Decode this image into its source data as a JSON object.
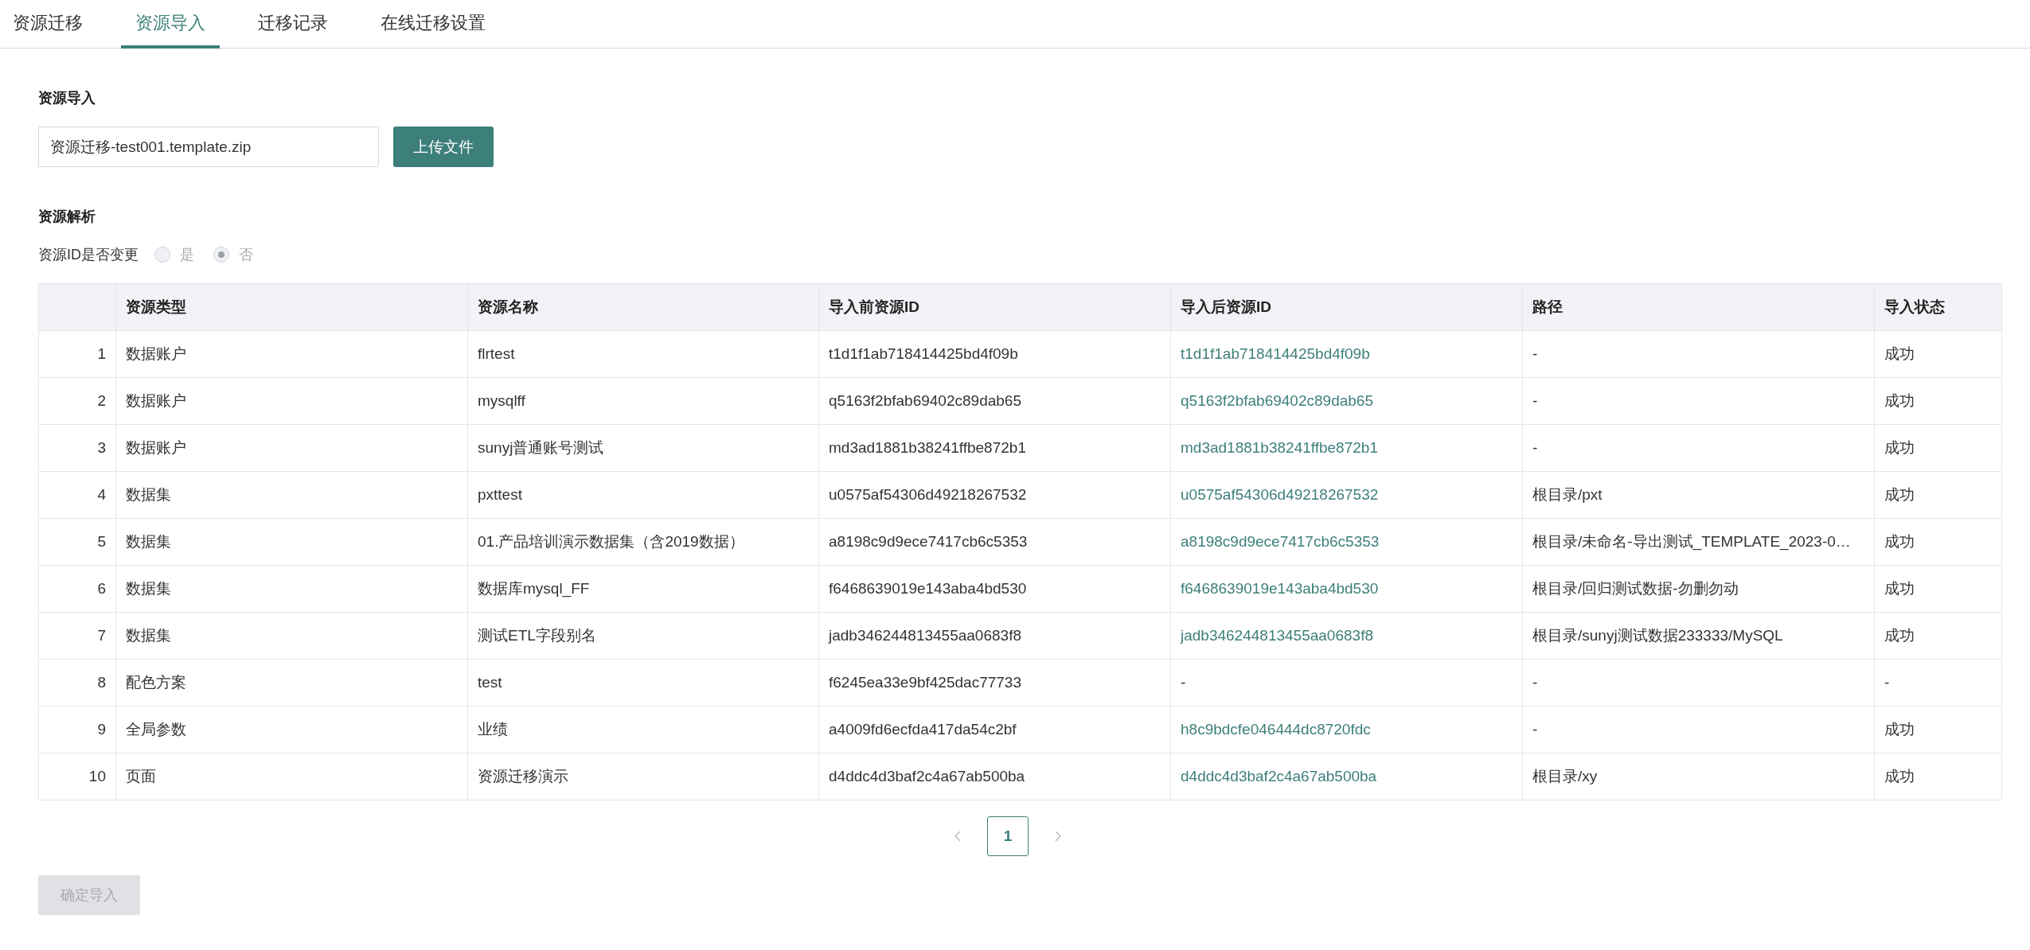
{
  "tabs": [
    {
      "label": "资源迁移",
      "selected": false
    },
    {
      "label": "资源导入",
      "selected": true
    },
    {
      "label": "迁移记录",
      "selected": false
    },
    {
      "label": "在线迁移设置",
      "selected": false
    }
  ],
  "import_section": {
    "title": "资源导入",
    "file_field": {
      "value": "资源迁移-test001.template.zip"
    },
    "upload_button": "上传文件"
  },
  "parse_section": {
    "title": "资源解析",
    "id_change": {
      "label": "资源ID是否变更",
      "disabled": true,
      "options": [
        {
          "label": "是",
          "selected": false
        },
        {
          "label": "否",
          "selected": true
        }
      ]
    }
  },
  "table": {
    "columns": [
      "资源类型",
      "资源名称",
      "导入前资源ID",
      "导入后资源ID",
      "路径",
      "导入状态"
    ],
    "rows": [
      {
        "index": "1",
        "type": "数据账户",
        "name": "flrtest",
        "before_id": "t1d1f1ab718414425bd4f09b",
        "after_id": "t1d1f1ab718414425bd4f09b",
        "linked": true,
        "path": "-",
        "status": "成功"
      },
      {
        "index": "2",
        "type": "数据账户",
        "name": "mysqlff",
        "before_id": "q5163f2bfab69402c89dab65",
        "after_id": "q5163f2bfab69402c89dab65",
        "linked": true,
        "path": "-",
        "status": "成功"
      },
      {
        "index": "3",
        "type": "数据账户",
        "name": "sunyj普通账号测试",
        "before_id": "md3ad1881b38241ffbe872b1",
        "after_id": "md3ad1881b38241ffbe872b1",
        "linked": true,
        "path": "-",
        "status": "成功"
      },
      {
        "index": "4",
        "type": "数据集",
        "name": "pxttest",
        "before_id": "u0575af54306d49218267532",
        "after_id": "u0575af54306d49218267532",
        "linked": true,
        "path": "根目录/pxt",
        "status": "成功"
      },
      {
        "index": "5",
        "type": "数据集",
        "name": "01.产品培训演示数据集（含2019数据）",
        "before_id": "a8198c9d9ece7417cb6c5353",
        "after_id": "a8198c9d9ece7417cb6c5353",
        "linked": true,
        "path": "根目录/未命名-导出测试_TEMPLATE_2023-0…",
        "status": "成功"
      },
      {
        "index": "6",
        "type": "数据集",
        "name": "数据库mysql_FF",
        "before_id": "f6468639019e143aba4bd530",
        "after_id": "f6468639019e143aba4bd530",
        "linked": true,
        "path": "根目录/回归测试数据-勿删勿动",
        "status": "成功"
      },
      {
        "index": "7",
        "type": "数据集",
        "name": "测试ETL字段别名",
        "before_id": "jadb346244813455aa0683f8",
        "after_id": "jadb346244813455aa0683f8",
        "linked": true,
        "path": "根目录/sunyj测试数据233333/MySQL",
        "status": "成功"
      },
      {
        "index": "8",
        "type": "配色方案",
        "name": "test",
        "before_id": "f6245ea33e9bf425dac77733",
        "after_id": "-",
        "linked": false,
        "path": "-",
        "status": "-"
      },
      {
        "index": "9",
        "type": "全局参数",
        "name": "业绩",
        "before_id": "a4009fd6ecfda417da54c2bf",
        "after_id": "h8c9bdcfe046444dc8720fdc",
        "linked": true,
        "path": "-",
        "status": "成功"
      },
      {
        "index": "10",
        "type": "页面",
        "name": "资源迁移演示",
        "before_id": "d4ddc4d3baf2c4a67ab500ba",
        "after_id": "d4ddc4d3baf2c4a67ab500ba",
        "linked": true,
        "path": "根目录/xy",
        "status": "成功"
      }
    ]
  },
  "pagination": {
    "prev_disabled": true,
    "next_disabled": true,
    "pages": [
      {
        "label": "1",
        "selected": true
      }
    ]
  },
  "confirm_button": {
    "label": "确定导入",
    "disabled": true
  }
}
